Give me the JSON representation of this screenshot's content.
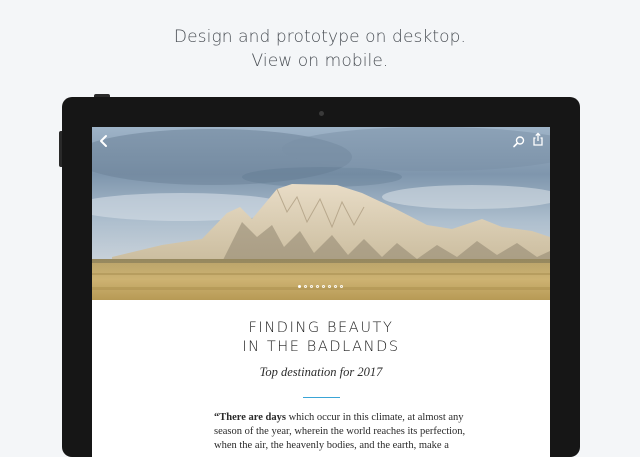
{
  "tagline": {
    "line1": "Design and prototype on desktop.",
    "line2": "View on mobile."
  },
  "app": {
    "icons": {
      "back": "chevron-left-icon",
      "search": "search-icon",
      "share": "share-icon"
    },
    "carousel": {
      "dot_count": 8,
      "active_index": 0
    },
    "article": {
      "title_line1": "FINDING BEAUTY",
      "title_line2": "IN THE BADLANDS",
      "subtitle": "Top destination for 2017",
      "body_lead": "“There are days",
      "body_line1_rest": " which occur in this climate, at almost any",
      "body_line2": "season of the year, wherein the world reaches its perfection,",
      "body_line3": "when the air, the heavenly bodies, and the earth, make a"
    }
  },
  "colors": {
    "page_background": "#f4f6f8",
    "tablet_bezel": "#161616",
    "accent_rule": "#3aa5d6",
    "tagline_text": "#4a4f55"
  }
}
